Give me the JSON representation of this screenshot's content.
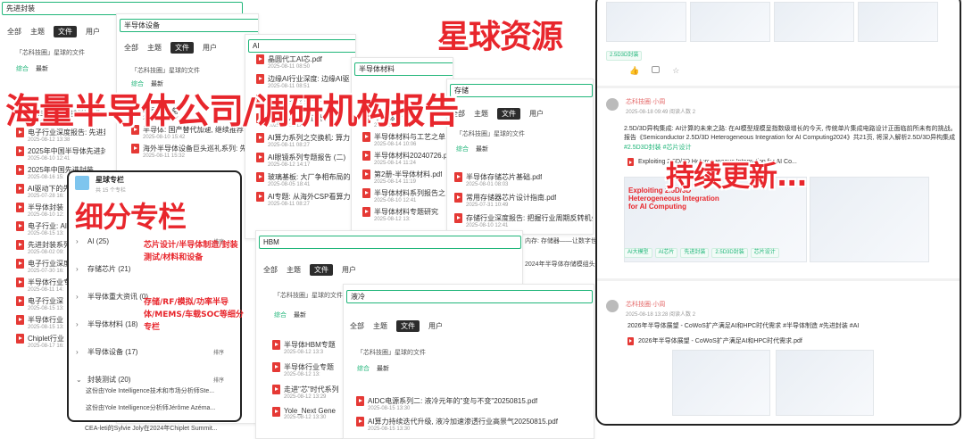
{
  "banners": {
    "title1": "星球资源",
    "title2": "海量半导体公司/调研机构报告",
    "title3": "细分专栏",
    "title4": "持续更新...",
    "red_note1": "芯片设计/半导体制造/封装测试/材料和设备",
    "red_note2": "存储/RF/模拟/功率半导体/MEMS/车载SOC等细分专栏"
  },
  "tabs_labels": [
    "全部",
    "主题",
    "文件",
    "用户"
  ],
  "sort_labels": [
    "综合",
    "最新"
  ],
  "planet_files": "「芯科技圈」星球的文件",
  "p1": {
    "search": "先进封装",
    "rows": [
      {
        "name": "2025年Yo先进封装行业",
        "date": "2025-07-29 16:40"
      },
      {
        "name": "电子行业深度报告: 先进封装",
        "date": "2025-08-12 13:38"
      },
      {
        "name": "2025年中国半导体先进封装行业",
        "date": "2025-08-10 12:41"
      },
      {
        "name": "2025年中国先进封装",
        "date": "2025-08-16 15:"
      },
      {
        "name": "AI驱动下的先进",
        "date": "2025-07-28 16:"
      },
      {
        "name": "半导体封装",
        "date": "2025-08-10 12:"
      },
      {
        "name": "电子行业: AI",
        "date": "2025-08-15 13:"
      },
      {
        "name": "先进封装系列",
        "date": "2025-08-02 09:"
      },
      {
        "name": "电子行业深度",
        "date": "2025-07-30 16:"
      },
      {
        "name": "半导体行业专",
        "date": "2025-08-11 14:"
      },
      {
        "name": "电子行业深",
        "date": "2025-08-15 13:"
      },
      {
        "name": "半导体行业",
        "date": "2025-08-15 13:"
      },
      {
        "name": "Chiplet行业",
        "date": "2025-08-17 16:"
      }
    ]
  },
  "p2": {
    "search": "半导体设备",
    "rows": [
      {
        "name": "半导体设备",
        "date": "2025-08-10 12:"
      },
      {
        "name": "半导体: 国产替代加速, 继续推荐",
        "date": "2025-08-10 15:42"
      },
      {
        "name": "海外半导体设备巨头巡礼系列: 先",
        "date": "2025-08-11 15:32"
      }
    ]
  },
  "p3": {
    "search": "AI",
    "rows": [
      {
        "name": "晶圆代工AI芯.pdf",
        "date": "2025-08-11 08:50"
      },
      {
        "name": "边缘AI行业深度: 边缘AI驱",
        "date": "2025-08-11 08:51"
      },
      {
        "name": "AI: 算力芯片深度",
        "date": "2025-08-11 08:27"
      },
      {
        "name": "阿里云AI应用正当时, 详",
        "date": "2025-08-11 12:"
      },
      {
        "name": "AI算力系列之交换机: 算力",
        "date": "2025-08-11 08:27"
      },
      {
        "name": "AI眼镜系列专题报告 (二)",
        "date": "2025-08-12 14:17"
      },
      {
        "name": "玻璃基板: 大厂争相布局的",
        "date": "2025-08-05 18:41"
      },
      {
        "name": "AI专题: 从海外CSP看算力",
        "date": "2025-08-11 08:27"
      }
    ]
  },
  "p4": {
    "search": "半导体材料",
    "rows": [
      {
        "name": "半导体材料",
        "date": "2025-08-14 10:"
      },
      {
        "name": "半导体材料与工艺之单",
        "date": "2025-08-14 10:06"
      },
      {
        "name": "半导体材料20240726.p",
        "date": "2025-08-14 11:24"
      },
      {
        "name": "第2册-半导体材料.pdf",
        "date": "2025-08-14 11:19"
      },
      {
        "name": "半导体材料系列报告之",
        "date": "2025-08-10 12:41"
      },
      {
        "name": "半导体材料专题研究",
        "date": "2025-08-12 13:"
      }
    ]
  },
  "p5": {
    "search": "存储",
    "rows": [
      {
        "name": "半导体存储芯片基础.pdf",
        "date": "2025-08-01 08:03"
      },
      {
        "name": "常用存储器芯片设计指南.pdf",
        "date": "2025-07-31 10:49"
      },
      {
        "name": "存储行业深度报告: 把握行业周期反转机会",
        "date": "2025-08-10 12:41"
      }
    ]
  },
  "p6": {
    "search": "HBM",
    "extra1": "内存: 存储器——让数字世界",
    "extra2": "2024年半导体存储模组头部",
    "rows": [
      {
        "name": "半导体HBM专题",
        "date": "2025-08-12 13:3"
      },
      {
        "name": "半导体行业专题",
        "date": "2025-08-12 13:"
      },
      {
        "name": "走进\"芯\"时代系列",
        "date": "2025-08-12 13:29"
      },
      {
        "name": "Yole_Next Gene",
        "date": "2025-08-12 13:30"
      }
    ]
  },
  "p7": {
    "search": "液冷",
    "rows": [
      {
        "name": "AIDC电源系列二: 液冷元年的\"变与不变\"20250815.pdf",
        "date": "2025-08-15 13:30"
      },
      {
        "name": "AI算力持续迭代升级, 液冷加速渗透行业高景气20250815.pdf",
        "date": "2025-08-15 13:30"
      }
    ]
  },
  "columns": {
    "title": "星球专栏",
    "count": "共 15 个专栏",
    "sort": "排序",
    "items": [
      {
        "label": "AI (25)"
      },
      {
        "label": "存储芯片 (21)"
      },
      {
        "label": "半导体重大资讯 (0)"
      },
      {
        "label": "半导体材料 (18)"
      },
      {
        "label": "半导体设备 (17)"
      },
      {
        "label": "封装测试 (20)"
      }
    ],
    "sub1": "这份由Yole Intelligence技术和市场分析师Ste...",
    "sub2": "这份由Yole Intelligence分析师Jérôme Azéma...",
    "bottom": "CEA-leti的Sylvie Joly在2024年Chiplet Summit..."
  },
  "feed": {
    "post1": {
      "tags": [
        "2.5D3D封装"
      ],
      "author": "芯科技圈·小周",
      "time": "2025-08-18 09:49 阅读人数 2",
      "text": "2.5D/3D异构集成: AI计算的未来之路: 在AI模型规模呈指数级增长的今天, 传统单片集成电路设计正面临前所未有的挑战。报告《Semiconductor 2.5D/3D Heterogeneous Integration for AI Computing2024》共21页, 将深入解析2.5D/3D异构集成技术如何突破现有瓶颈, 为AI计算提供全新的可能性。",
      "hashtags": "#2.5D3D封装 #芯片设计",
      "file": "Exploiting 2.5D/3D Heterogeneous Integration for AI Co...",
      "chips": [
        "AI大模型",
        "AI芯片",
        "先进封装",
        "2.5D3D封装",
        "芯片设计"
      ],
      "doc_title": "Exploiting 2.5D/3D Heterogeneous Integration for AI Computing"
    },
    "post2": {
      "author": "芯科技圈·小周",
      "time": "2025-08-18 13:28 阅读人数 2",
      "text": "2026年半导体展望 - CoWoS扩产满足AI和HPC时代需求 #半导体制造 #先进封装 #AI",
      "file": "2026年半导体展望 - CoWoS扩产满足AI和HPC时代需求.pdf"
    }
  },
  "colors": {
    "red": "#e8262c",
    "green": "#21b67a",
    "dark": "#2c2c2c"
  }
}
